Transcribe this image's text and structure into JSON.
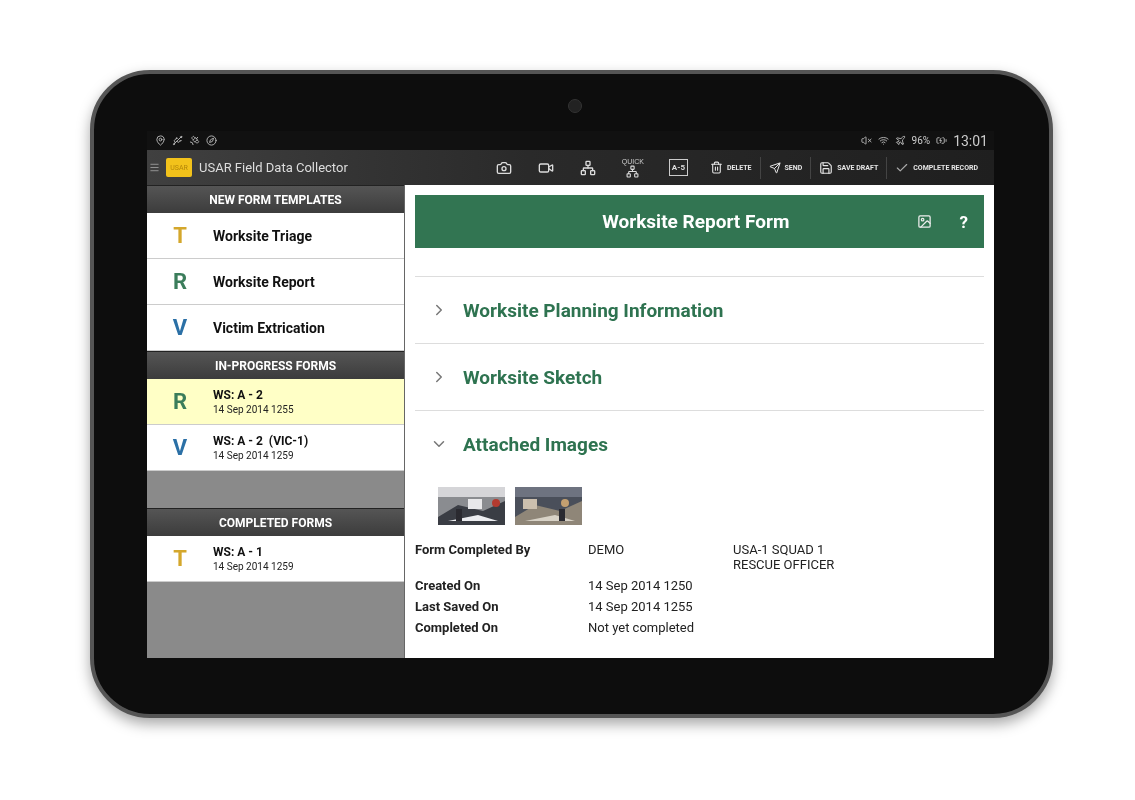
{
  "status_bar": {
    "battery": "96%",
    "time": "13:01"
  },
  "app_bar": {
    "logo": "USAR",
    "title": "USAR Field Data Collector",
    "quick_label": "QUICK",
    "box_label": "A-5",
    "actions": [
      {
        "kind": "delete",
        "label": "DELETE"
      },
      {
        "kind": "send",
        "label": "SEND"
      },
      {
        "kind": "save",
        "label": "SAVE DRAFT"
      },
      {
        "kind": "complete",
        "label": "COMPLETE RECORD"
      }
    ]
  },
  "sidebar": {
    "sections": [
      {
        "title": "NEW FORM TEMPLATES",
        "spaced": false,
        "items": [
          {
            "letter": "T",
            "color": "#d4a72c",
            "title": "Worksite Triage",
            "selected": false
          },
          {
            "letter": "R",
            "color": "#3b7d5b",
            "title": "Worksite Report",
            "selected": false
          },
          {
            "letter": "V",
            "color": "#2b70a6",
            "title": "Victim Extrication",
            "selected": false
          }
        ]
      },
      {
        "title": "IN-PROGRESS FORMS",
        "spaced": false,
        "items": [
          {
            "letter": "R",
            "color": "#3b7d5b",
            "title": "WS: A - 2",
            "subtitle": "14 Sep 2014 1255",
            "selected": true
          },
          {
            "letter": "V",
            "color": "#2b70a6",
            "title": "WS: A - 2  (VIC-1)",
            "subtitle": "14 Sep 2014 1259",
            "selected": false
          }
        ]
      },
      {
        "title": "COMPLETED FORMS",
        "spaced": true,
        "items": [
          {
            "letter": "T",
            "color": "#d4a72c",
            "title": "WS: A - 1",
            "subtitle": "14 Sep 2014 1259",
            "selected": false
          }
        ]
      }
    ]
  },
  "form": {
    "title": "Worksite Report Form",
    "help": "?",
    "sections": [
      {
        "title": "Worksite Planning Information",
        "expanded": false
      },
      {
        "title": "Worksite Sketch",
        "expanded": false
      },
      {
        "title": "Attached Images",
        "expanded": true
      }
    ],
    "details": [
      {
        "label": "Form Completed By",
        "value": "DEMO",
        "extra": [
          "USA-1 SQUAD 1",
          "RESCUE OFFICER"
        ]
      },
      {
        "label": "Created On",
        "value": "14 Sep 2014 1250"
      },
      {
        "label": "Last Saved On",
        "value": "14 Sep 2014 1255"
      },
      {
        "label": "Completed On",
        "value": "Not yet completed"
      }
    ]
  }
}
